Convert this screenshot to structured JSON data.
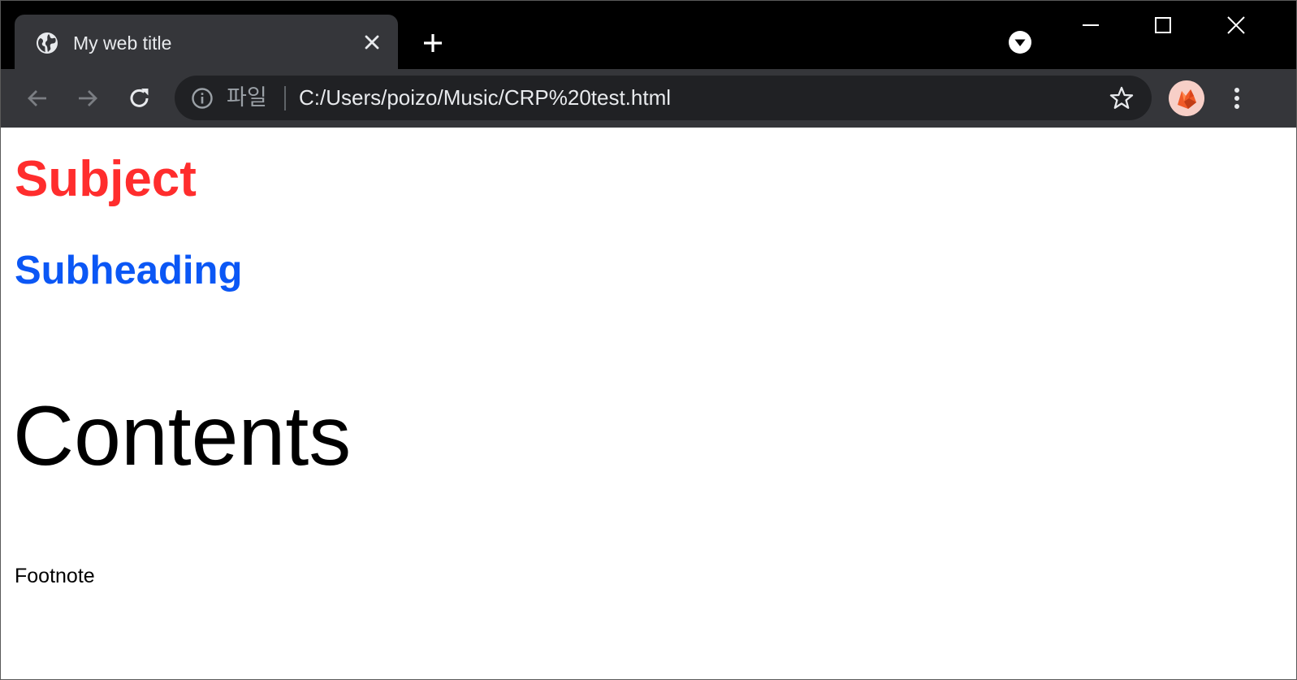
{
  "tab": {
    "title": "My web title",
    "favicon": "globe-icon",
    "close_icon": "close-icon"
  },
  "tabstrip": {
    "new_tab_icon": "plus-icon",
    "tab_search_icon": "chevron-down-circle-icon"
  },
  "window_controls": {
    "minimize_icon": "minimize-icon",
    "maximize_icon": "maximize-icon",
    "close_icon": "close-icon"
  },
  "toolbar": {
    "back_icon": "arrow-left-icon",
    "forward_icon": "arrow-right-icon",
    "reload_icon": "reload-icon",
    "omnibox": {
      "info_icon": "info-icon",
      "scheme_chip": "파일",
      "url": "C:/Users/poizo/Music/CRP%20test.html",
      "bookmark_icon": "star-icon"
    },
    "profile_icon": "avatar-fox-icon",
    "menu_icon": "more-vert-icon"
  },
  "page": {
    "subject": "Subject",
    "subheading": "Subheading",
    "contents": "Contents",
    "footnote": "Footnote"
  },
  "colors": {
    "frame": "#000000",
    "toolbar": "#35363a",
    "omnibox": "#202124",
    "subject": "#ff2d2d",
    "subheading": "#0b57f5",
    "text": "#000000"
  }
}
